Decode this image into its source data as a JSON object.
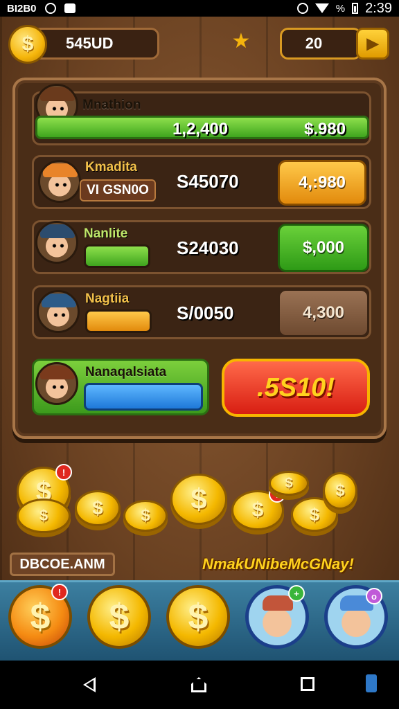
{
  "status_bar": {
    "left_text": "BI2B0",
    "time": "2:39",
    "battery_text": "%"
  },
  "hud": {
    "balance": "545UD",
    "coin_symbol": "$",
    "level": "20"
  },
  "players": [
    {
      "name": "Mnathion",
      "score": "1,2,400",
      "value": "$.980",
      "bar_fraction": 1.0
    },
    {
      "name": "Kmadita",
      "tag": "VI GSN0O",
      "score": "S45070",
      "button": "4,:980"
    },
    {
      "name": "Nanlite",
      "score": "S24030",
      "button": "$,000"
    },
    {
      "name": "Nagtiia",
      "score": "S/0050",
      "button": "4,300"
    },
    {
      "name": "Nanaqalsiata",
      "action_button": ".5S10!"
    }
  ],
  "footer": {
    "left_label": "DBCOE.ANM",
    "right_label": "NmakUNibeMcGNay!"
  },
  "colors": {
    "green": "#4cb82a",
    "orange": "#f2a31b",
    "red": "#e8341f",
    "blue": "#2f8fe6",
    "wood": "#6b4222",
    "gold": "#f4b800"
  },
  "icons": [
    "star-icon",
    "coin-icon",
    "back-icon",
    "home-icon",
    "recent-apps-icon"
  ]
}
